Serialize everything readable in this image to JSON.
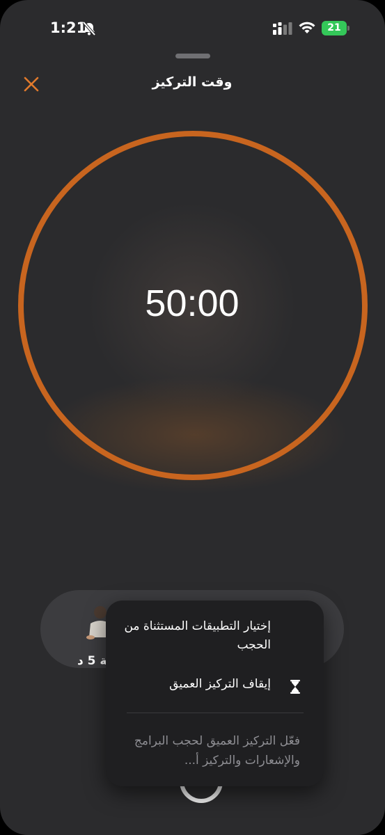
{
  "status_bar": {
    "time": "1:21",
    "battery": "21"
  },
  "header": {
    "title": "وقت التركيز"
  },
  "timer": {
    "value": "50:00",
    "ring_color": "#c8651f"
  },
  "pill": {
    "label": "حة 5 د"
  },
  "menu": {
    "exceptions_label": "إختيار التطبيقات المستثناة من الحجب",
    "stop_label": "إيقاف التركيز العميق",
    "description": "فعّل التركيز العميق لحجب البرامج والإشعارات والتركيز أ..."
  },
  "icons": [
    "bell-slash-icon",
    "signal-icon",
    "wifi-icon",
    "battery-icon",
    "close-icon",
    "hourglass-icon"
  ]
}
